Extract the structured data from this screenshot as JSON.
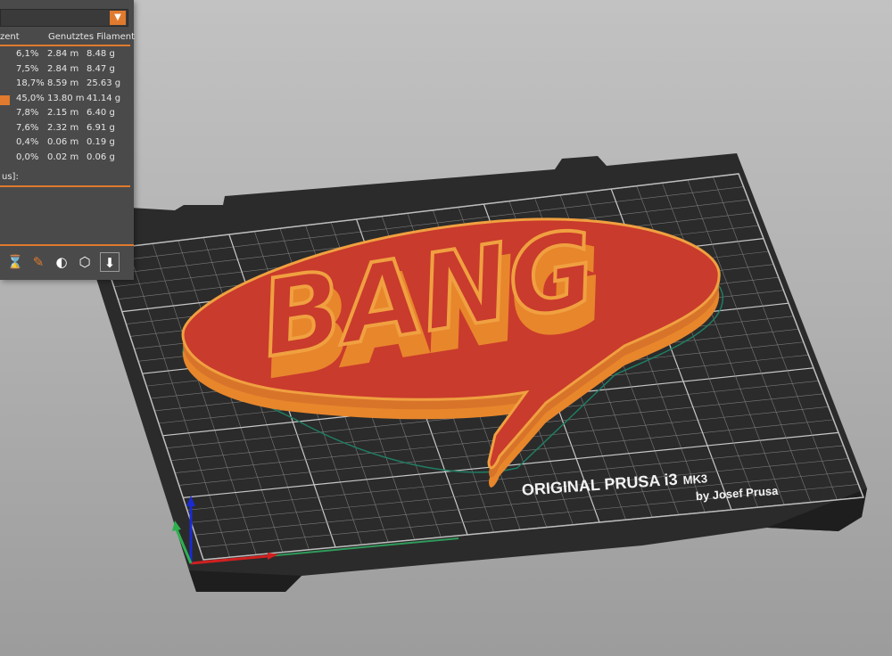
{
  "stats": {
    "col_percent_header": "zent",
    "col_filament_header": "Genutztes Filament",
    "rows": [
      {
        "pct": "6,1%",
        "length": "2.84 m",
        "weight": "8.48 g",
        "color": ""
      },
      {
        "pct": "7,5%",
        "length": "2.84 m",
        "weight": "8.47 g",
        "color": ""
      },
      {
        "pct": "18,7%",
        "length": "8.59 m",
        "weight": "25.63 g",
        "color": ""
      },
      {
        "pct": "45,0%",
        "length": "13.80 m",
        "weight": "41.14 g",
        "color": "#e07a2e"
      },
      {
        "pct": "7,8%",
        "length": "2.15 m",
        "weight": "6.40 g",
        "color": ""
      },
      {
        "pct": "7,6%",
        "length": "2.32 m",
        "weight": "6.91 g",
        "color": ""
      },
      {
        "pct": "0,4%",
        "length": "0.06 m",
        "weight": "0.19 g",
        "color": ""
      },
      {
        "pct": "0,0%",
        "length": "0.02 m",
        "weight": "0.06 g",
        "color": ""
      }
    ],
    "subheading": "us]:"
  },
  "toolbar": {
    "icons": [
      "hourglass-icon",
      "brush-icon",
      "contrast-icon",
      "wireframe-cube-icon",
      "export-arrow-icon"
    ],
    "glyphs": [
      "⌛",
      "✎",
      "◐",
      "⬡",
      "⬇"
    ]
  },
  "bed": {
    "brand_line1": "ORIGINAL PRUSA i3",
    "brand_model": "MK3",
    "brand_line2": "by Josef Prusa"
  },
  "model": {
    "text": "BANG"
  },
  "colors": {
    "accent": "#e07a2e",
    "panel_bg": "#4a4a4a",
    "bed": "#2b2b2b",
    "grid": "#9a9a9a",
    "model_top": "#c93b2c",
    "model_wall": "#e8862c",
    "model_outline": "#1f7d63"
  }
}
